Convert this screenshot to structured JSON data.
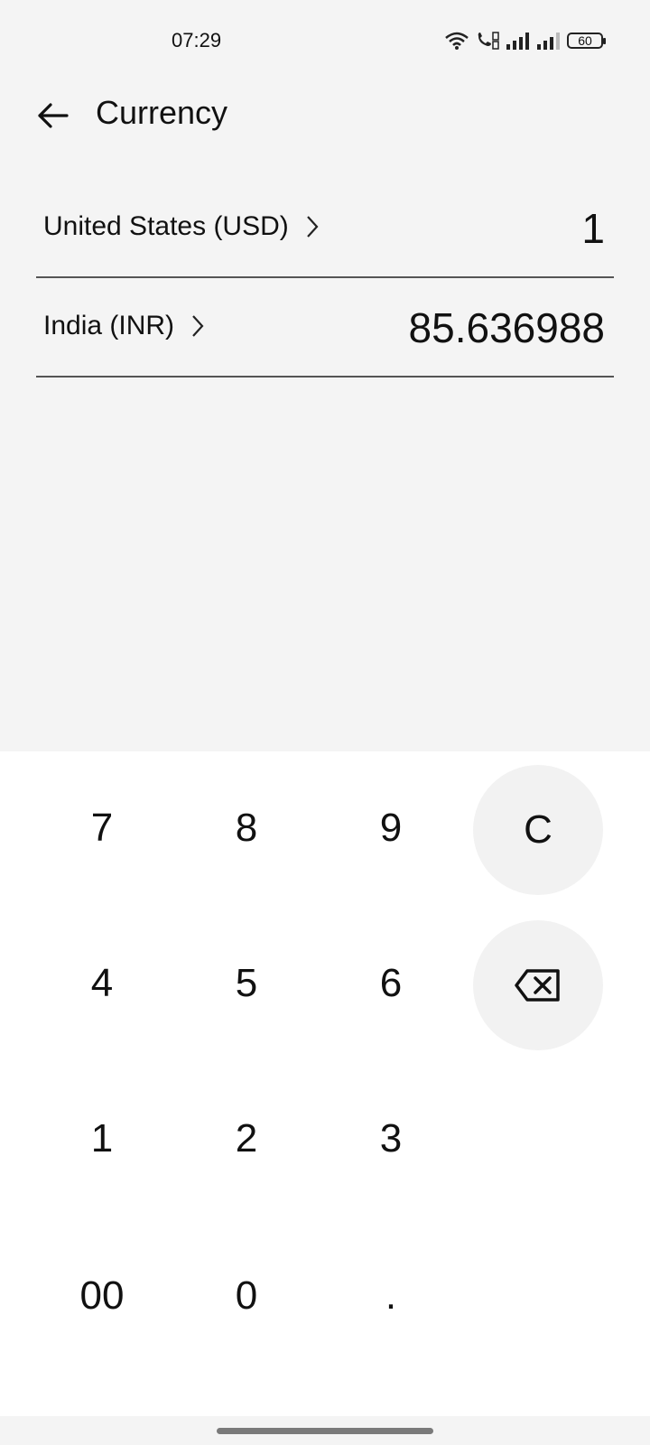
{
  "status_bar": {
    "time": "07:29",
    "battery": "60",
    "icons": [
      "wifi-icon",
      "volte-call-icon",
      "signal-strength-icon",
      "signal-strength-icon",
      "battery-icon"
    ]
  },
  "app_bar": {
    "back_icon": "arrow-left-icon",
    "title": "Currency"
  },
  "currencies": [
    {
      "label": "United States (USD)",
      "value": "1",
      "icon": "chevron-right-icon"
    },
    {
      "label": "India (INR)",
      "value": "85.636988",
      "icon": "chevron-right-icon"
    }
  ],
  "keypad": {
    "rows": [
      [
        "7",
        "8",
        "9",
        "C"
      ],
      [
        "4",
        "5",
        "6",
        "backspace"
      ],
      [
        "1",
        "2",
        "3"
      ],
      [
        "00",
        "0",
        "."
      ]
    ],
    "backspace_icon": "backspace-icon"
  },
  "colors": {
    "background": "#f4f4f4",
    "keypad_background": "#ffffff",
    "round_key": "#f2f2f2",
    "divider": "#555555"
  }
}
